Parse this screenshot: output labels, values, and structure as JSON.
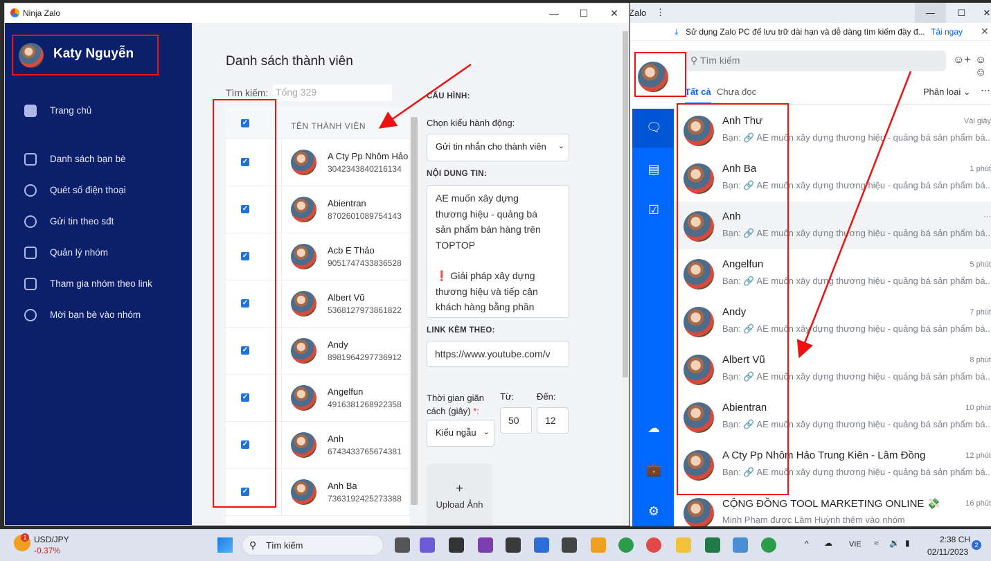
{
  "ninja": {
    "title": "Ninja Zalo",
    "user_name": "Katy Nguyễn",
    "nav": [
      "Trang chủ",
      "Danh sách bạn bè",
      "Quét số điện thoại",
      "Gửi tin theo sđt",
      "Quản lý nhóm",
      "Tham gia nhóm theo link",
      "Mời bạn bè vào nhóm"
    ],
    "main": {
      "heading": "Danh sách thành viên",
      "search_label": "Tìm kiếm:",
      "search_placeholder": "Tổng 329",
      "column_member": "TÊN THÀNH VIÊN",
      "members": [
        {
          "name": "A Cty Pp Nhôm Hảo",
          "id": "3042343840216134"
        },
        {
          "name": "Abientran",
          "id": "8702601089754143"
        },
        {
          "name": "Acb E Thảo",
          "id": "9051747433836528"
        },
        {
          "name": "Albert Vũ",
          "id": "5368127973861822"
        },
        {
          "name": "Andy",
          "id": "8981964297736912"
        },
        {
          "name": "Angelfun",
          "id": "4916381268922358"
        },
        {
          "name": "Anh",
          "id": "6743433765674381"
        },
        {
          "name": "Anh Ba",
          "id": "7363192425273388"
        }
      ]
    },
    "config": {
      "section_title": "CẤU HÌNH:",
      "action_label": "Chọn kiểu hành động:",
      "action_value": "Gửi tin nhắn cho thành viên",
      "content_title": "NỘI DUNG TIN:",
      "content_lines": [
        "AE muốn xây dựng",
        "thương hiệu - quảng bá",
        "sản phẩm bán hàng trên",
        "TOPTOP",
        "",
        "❗ Giải pháp xây dựng",
        "thương hiệu và tiếp cận",
        "khách hàng bằng phần"
      ],
      "link_title": "LINK KÈM THEO:",
      "link_value": "https://www.youtube.com/v",
      "interval_label": "Thời gian giãn cách (giây)",
      "interval_required": "*:",
      "interval_value": "Kiểu ngẫu",
      "from_label": "Từ:",
      "from_value": "50",
      "to_label": "Đến:",
      "to_value": "12",
      "upload_plus": "+",
      "upload_label": "Upload Ảnh"
    }
  },
  "zalo": {
    "title": "Zalo",
    "banner_text": "Sử dụng Zalo PC để lưu trữ dài hạn và dễ dàng tìm kiếm đầy đ...",
    "banner_link": "Tải ngay",
    "search_placeholder": "Tìm kiếm",
    "tab_all": "Tất cả",
    "tab_unread": "Chưa đọc",
    "classify": "Phân loại",
    "conversations": [
      {
        "name": "Anh Thư",
        "msg": "Bạn: 🔗 AE muốn xây dựng thương hiệu - quảng bá sản phẩm bá...",
        "time": "Vài giây"
      },
      {
        "name": "Anh Ba",
        "msg": "Bạn: 🔗 AE muốn xây dựng thương hiệu - quảng bá sản phẩm bá...",
        "time": "1 phút"
      },
      {
        "name": "Anh",
        "msg": "Bạn: 🔗 AE muốn xây dựng thương hiệu - quảng bá sản phẩm bá...",
        "time": "···"
      },
      {
        "name": "Angelfun",
        "msg": "Bạn: 🔗 AE muốn xây dựng thương hiệu - quảng bá sản phẩm bá...",
        "time": "5 phút"
      },
      {
        "name": "Andy",
        "msg": "Bạn: 🔗 AE muốn xây dựng thương hiệu - quảng bá sản phẩm bá...",
        "time": "7 phút"
      },
      {
        "name": "Albert Vũ",
        "msg": "Bạn: 🔗 AE muốn xây dựng thương hiệu - quảng bá sản phẩm bá...",
        "time": "8 phút"
      },
      {
        "name": "Abientran",
        "msg": "Bạn: 🔗 AE muốn xây dựng thương hiệu - quảng bá sản phẩm bá...",
        "time": "10 phút"
      },
      {
        "name": "A Cty Pp Nhôm Hảo Trung Kiên - Lâm Đồng",
        "msg": "Bạn: 🔗 AE muốn xây dựng thương hiệu - quảng bá sản phẩm bá...",
        "time": "12 phút"
      },
      {
        "name": "CỘNG ĐỒNG TOOL MARKETING ONLINE 💸",
        "msg": "Minh Phạm được Lâm Huỳnh thêm vào nhóm",
        "time": "16 phút"
      }
    ]
  },
  "taskbar": {
    "ticker": "USD/JPY",
    "ticker_change": "-0.37%",
    "search": "Tìm kiếm",
    "lang": "VIE",
    "time": "2:38 CH",
    "date": "02/11/2023",
    "notif_count": "2"
  }
}
